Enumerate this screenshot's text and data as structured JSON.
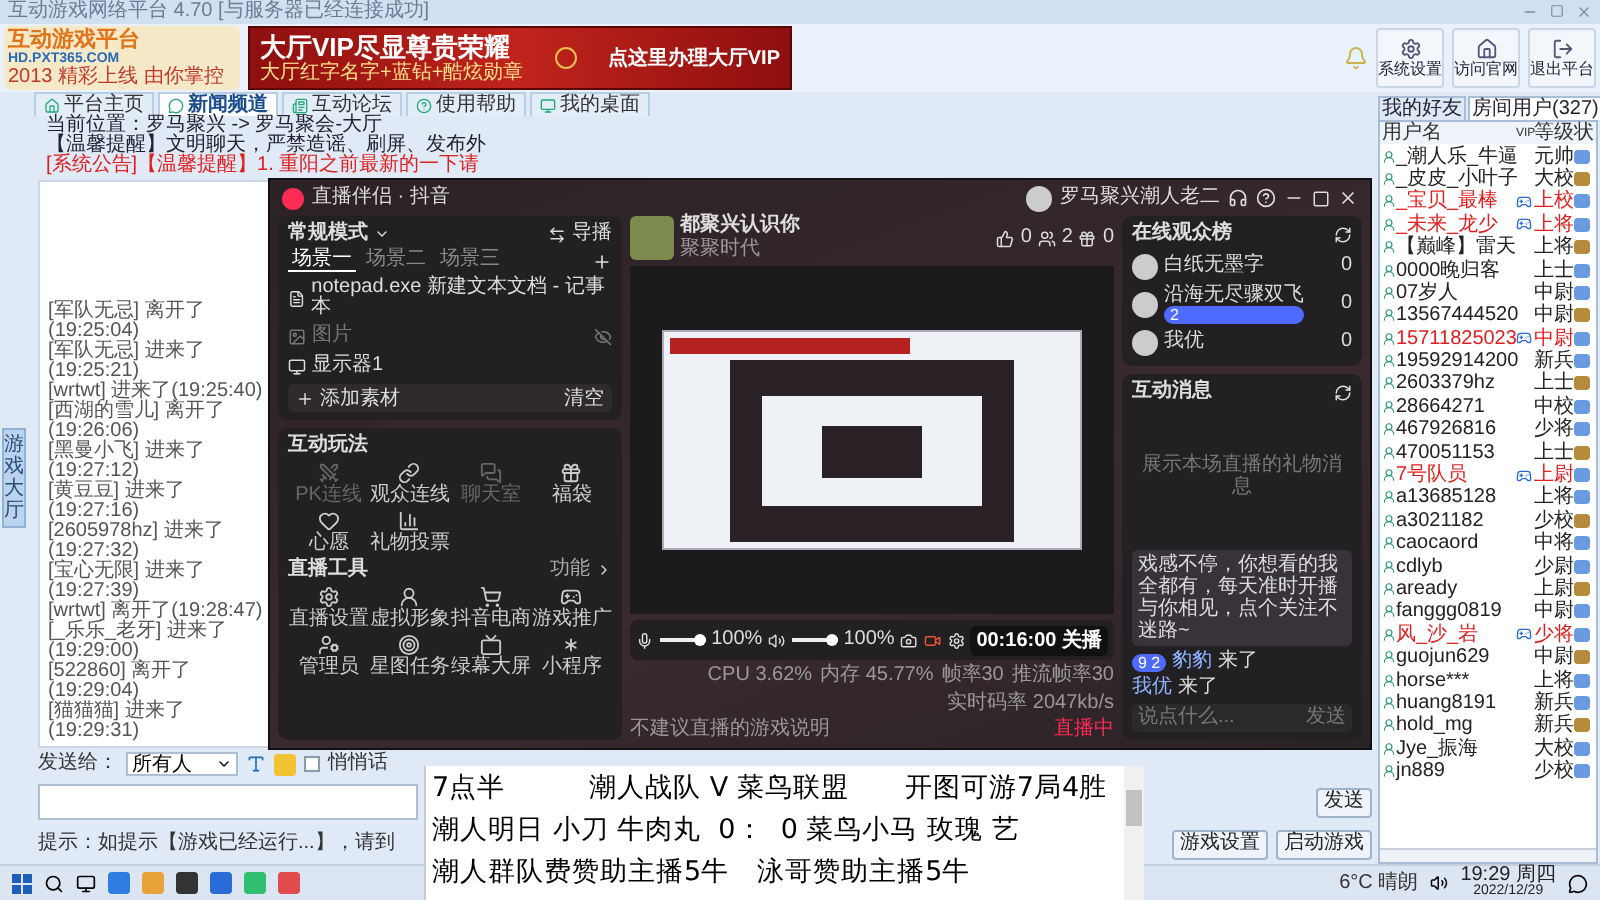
{
  "window": {
    "title": "互动游戏网络平台 4.70 [与服务器已经连接成功]"
  },
  "logo": {
    "name": "互动游戏平台",
    "url": "HD.PXT365.COM",
    "slogan": "2013 精彩上线 由你掌控"
  },
  "banner": {
    "headline": "大厅VIP尽显尊贵荣耀",
    "subline": "大厅红字名字+蓝钻+酷炫勋章",
    "action": "点这里办理大厅VIP"
  },
  "toolbar": [
    {
      "label": "系统设置",
      "kind": "settings"
    },
    {
      "label": "访问官网",
      "kind": "home"
    },
    {
      "label": "退出平台",
      "kind": "exit"
    }
  ],
  "nav_tabs": [
    {
      "label": "平台主页",
      "kind": "home",
      "selected": false
    },
    {
      "label": "新闻频道",
      "kind": "news",
      "selected": true
    },
    {
      "label": "互动论坛",
      "kind": "forum",
      "selected": false
    },
    {
      "label": "使用帮助",
      "kind": "help",
      "selected": false
    },
    {
      "label": "我的桌面",
      "kind": "desktop",
      "selected": false
    }
  ],
  "location": "当前位置：罗马聚兴 -> 罗马聚会-大厅",
  "notices": [
    {
      "text": "【温馨提醒】文明聊天，严禁造谣、刷屏、发布外",
      "kind": "normal"
    },
    {
      "text": "[系统公告]【温馨提醒】1. 重阳之前最新的一下请",
      "kind": "alert"
    }
  ],
  "side_tab": "游戏大厅",
  "chat_log": [
    "[军队无忌] 离开了(19:25:04)",
    "[军队无忌] 进来了(19:25:21)",
    "[wrtwt] 进来了(19:25:40)",
    "[西湖的雪儿] 离开了(19:26:06)",
    "[黑曼小飞] 进来了(19:27:12)",
    "[黄豆豆] 进来了(19:27:16)",
    "[2605978hz] 进来了(19:27:32)",
    "[宝心无限] 进来了(19:27:39)",
    "[wrtwt] 离开了(19:28:47)",
    "[_乐乐_老牙] 进来了(19:29:00)",
    "[522860] 离开了(19:29:04)",
    "[猫猫猫] 进来了(19:29:31)"
  ],
  "send": {
    "target": "发送给：",
    "recipient": "所有人",
    "whisper": {
      "label": "悄悄话",
      "checked": false
    },
    "button": "发送"
  },
  "tip": "提示：如提示【游戏已经运行...】，请到",
  "game_buttons": [
    "游戏设置",
    "启动游戏"
  ],
  "live": {
    "app_title": "直播伴侣 · 抖音",
    "account": "罗马聚兴潮人老二",
    "mode": "常规模式",
    "director": "导播",
    "scenes": [
      {
        "label": "场景一",
        "selected": true
      },
      {
        "label": "场景二",
        "selected": false
      },
      {
        "label": "场景三",
        "selected": false
      }
    ],
    "sources": [
      {
        "label": "notepad.exe 新建文本文档 - 记事本",
        "kind": "window",
        "hidden": false
      },
      {
        "label": "图片",
        "kind": "image",
        "hidden": true
      },
      {
        "label": "显示器1",
        "kind": "display",
        "hidden": false
      }
    ],
    "add_source": "添加素材",
    "clear": "清空",
    "play_title": "互动玩法",
    "play_items": [
      {
        "label": "PK连线",
        "kind": "pk",
        "disabled": true
      },
      {
        "label": "观众连线",
        "kind": "link",
        "disabled": false
      },
      {
        "label": "聊天室",
        "kind": "chat",
        "disabled": true
      },
      {
        "label": "福袋",
        "kind": "bag",
        "disabled": false
      },
      {
        "label": "心愿",
        "kind": "wish",
        "disabled": false
      },
      {
        "label": "礼物投票",
        "kind": "vote",
        "disabled": false
      }
    ],
    "tools_title": "直播工具",
    "tools_more": "功能",
    "tool_items": [
      {
        "label": "直播设置",
        "kind": "settings"
      },
      {
        "label": "虚拟形象",
        "kind": "avatar"
      },
      {
        "label": "抖音电商",
        "kind": "cart"
      },
      {
        "label": "游戏推广",
        "kind": "game"
      },
      {
        "label": "管理员",
        "kind": "admin"
      },
      {
        "label": "星图任务",
        "kind": "task"
      },
      {
        "label": "绿幕大屏",
        "kind": "screen"
      },
      {
        "label": "小程序",
        "kind": "mini"
      }
    ],
    "streamer": {
      "name": "都聚兴认识你",
      "subtitle": "聚聚时代"
    },
    "stats": [
      {
        "value": "0",
        "kind": "likes"
      },
      {
        "value": "2",
        "kind": "viewers"
      },
      {
        "value": "0",
        "kind": "gifts"
      }
    ],
    "mic": {
      "level": 1,
      "reading": "100%"
    },
    "speaker": {
      "level": 1,
      "reading": "100%"
    },
    "timer": "00:16:00 关播",
    "game_hint": "不建议直播的游戏说明",
    "metrics": [
      "CPU 3.62%",
      "内存 45.77%",
      "帧率30",
      "推流帧率30",
      "实时码率 2047kb/s"
    ],
    "live_badge": "直播中",
    "viewers_title": "在线观众榜",
    "viewers": [
      {
        "name": "白纸无墨字",
        "score": "0"
      },
      {
        "name": "沿海无尽骤双飞",
        "score": "0",
        "badge": "2"
      },
      {
        "name": "我优",
        "score": "0"
      }
    ],
    "messages_title": "互动消息",
    "messages_placeholder": "展示本场直播的礼物消息",
    "announcement": "戏感不停，你想看的我全都有，每天准时开播与你相见，点个关注不迷路~",
    "arrivals": [
      {
        "badge": "9 2",
        "name": "豹豹",
        "action": "来了"
      },
      {
        "name": "我优",
        "action": "来了"
      }
    ],
    "chat_placeholder": "说点什么...",
    "chat_send": "发送"
  },
  "user_panel": {
    "tabs": [
      {
        "label": "我的好友",
        "selected": false
      },
      {
        "label": "房间用户(327)",
        "selected": true
      }
    ],
    "columns": [
      "用户名",
      "VIP",
      "等级",
      "状"
    ],
    "rows": [
      {
        "name": "_潮人乐_牛逼",
        "level": "元帅",
        "vip": false
      },
      {
        "name": "_皮皮_小叶子",
        "level": "大校",
        "vip": false
      },
      {
        "name": "_宝贝_最棒",
        "level": "上校",
        "vip": true
      },
      {
        "name": "_未来_龙少",
        "level": "上将",
        "vip": true
      },
      {
        "name": "【巅峰】雷天",
        "level": "上将",
        "vip": false
      },
      {
        "name": "0000晚归客",
        "level": "上士",
        "vip": false
      },
      {
        "name": "07岁人",
        "level": "中尉",
        "vip": false
      },
      {
        "name": "13567444520",
        "level": "中尉",
        "vip": false
      },
      {
        "name": "15711825023",
        "level": "中尉",
        "vip": true
      },
      {
        "name": "19592914200",
        "level": "新兵",
        "vip": false
      },
      {
        "name": "2603379hz",
        "level": "上士",
        "vip": false
      },
      {
        "name": "28664271",
        "level": "中校",
        "vip": false
      },
      {
        "name": "467926816",
        "level": "少将",
        "vip": false
      },
      {
        "name": "470051153",
        "level": "上士",
        "vip": false
      },
      {
        "name": "7号队员",
        "level": "上尉",
        "vip": true
      },
      {
        "name": "a13685128",
        "level": "上将",
        "vip": false
      },
      {
        "name": "a3021182",
        "level": "少校",
        "vip": false
      },
      {
        "name": "caocaord",
        "level": "中将",
        "vip": false
      },
      {
        "name": "cdlyb",
        "level": "少尉",
        "vip": false
      },
      {
        "name": "aready",
        "level": "上尉",
        "vip": false
      },
      {
        "name": "fanggg0819",
        "level": "中尉",
        "vip": false
      },
      {
        "name": "风_沙_岩",
        "level": "少将",
        "vip": true
      },
      {
        "name": "guojun629",
        "level": "中尉",
        "vip": false
      },
      {
        "name": "horse***",
        "level": "上将",
        "vip": false
      },
      {
        "name": "huang8191",
        "level": "新兵",
        "vip": false
      },
      {
        "name": "hold_mg",
        "level": "新兵",
        "vip": false
      },
      {
        "name": "Jye_振海",
        "level": "大校",
        "vip": false
      },
      {
        "name": "jn889",
        "level": "少校",
        "vip": false
      }
    ]
  },
  "notepad": {
    "lines": [
      "7点半　　　潮人战队 V 菜鸟联盟　　开图可游7局4胜",
      "潮人明日 小刀 牛肉丸  0：  0 菜鸟小马 玫瑰 艺",
      "潮人群队费赞助主播5牛　泳哥赞助主播5牛"
    ]
  },
  "taskbar": {
    "weather": "6°C 晴朗",
    "time": "19:29 周四",
    "date": "2022/12/29"
  }
}
